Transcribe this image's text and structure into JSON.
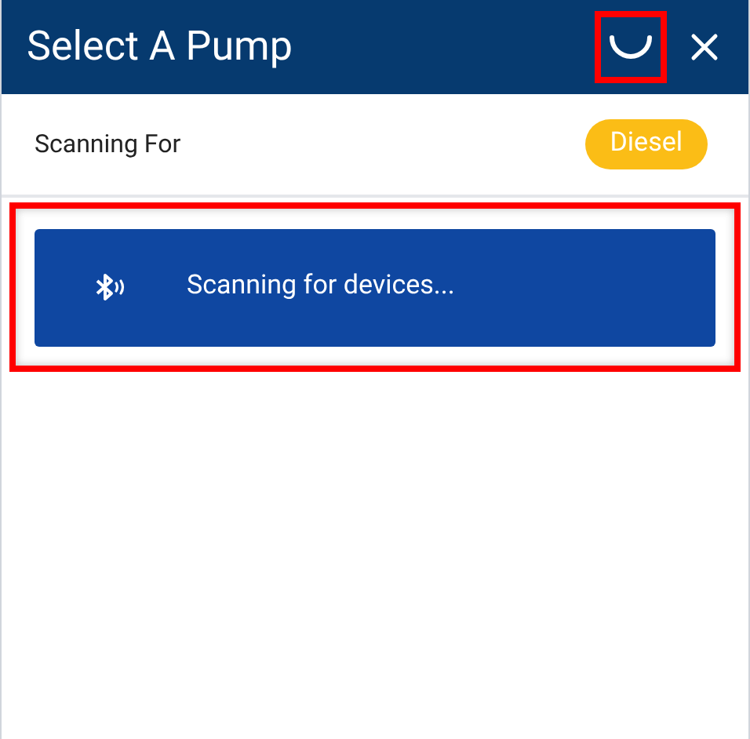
{
  "header": {
    "title": "Select A Pump",
    "loading": true
  },
  "filter": {
    "label": "Scanning For",
    "fuel": "Diesel"
  },
  "scan_button": {
    "label": "Scanning for devices..."
  }
}
